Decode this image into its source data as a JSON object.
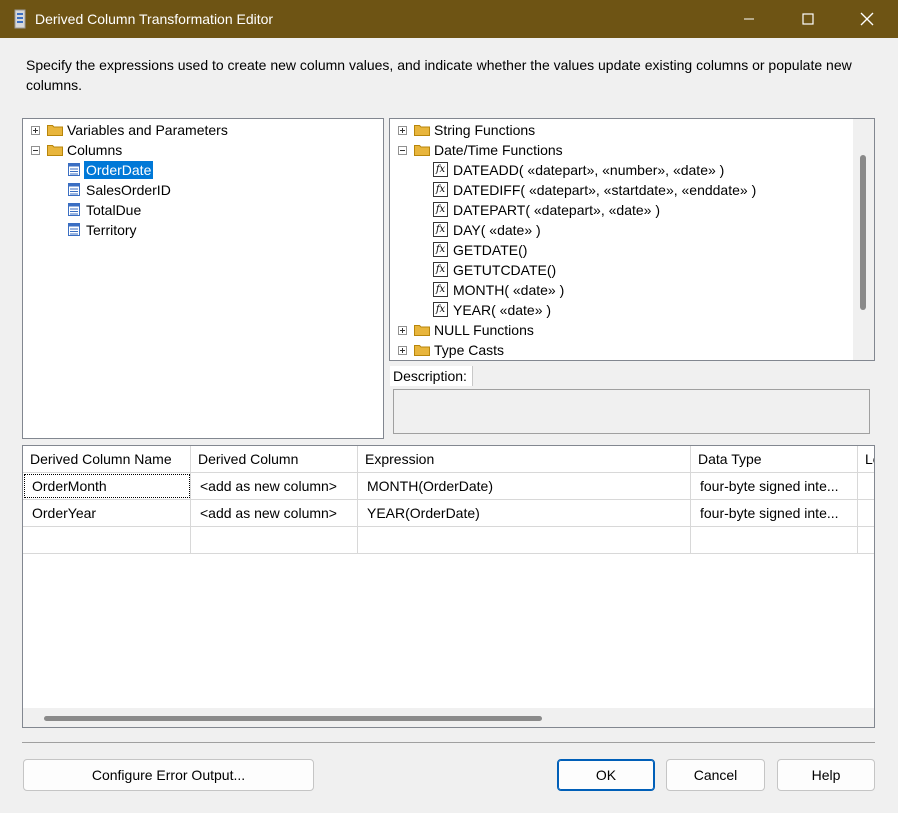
{
  "window": {
    "title": "Derived Column Transformation Editor",
    "minimize": "",
    "maximize": "☐",
    "close": "✕"
  },
  "instructions": "Specify the expressions used to create new column values, and indicate whether the values update existing columns or populate new columns.",
  "left_tree": {
    "variables": "Variables and Parameters",
    "columns": "Columns",
    "column_items": [
      "OrderDate",
      "SalesOrderID",
      "TotalDue",
      "Territory"
    ],
    "selected": "OrderDate"
  },
  "right_tree": {
    "string_functions": "String Functions",
    "datetime_functions": "Date/Time Functions",
    "functions": [
      "DATEADD( «datepart», «number», «date» )",
      "DATEDIFF( «datepart», «startdate», «enddate» )",
      "DATEPART( «datepart», «date» )",
      "DAY( «date» )",
      "GETDATE()",
      "GETUTCDATE()",
      "MONTH( «date» )",
      "YEAR( «date» )"
    ],
    "null_functions": "NULL Functions",
    "type_casts": "Type Casts",
    "fx_glyph": "fx"
  },
  "description": {
    "label": "Description:",
    "value": ""
  },
  "grid": {
    "headers": [
      "Derived Column Name",
      "Derived Column",
      "Expression",
      "Data Type",
      "Le"
    ],
    "rows": [
      [
        "OrderMonth",
        "<add as new column>",
        "MONTH(OrderDate)",
        "four-byte signed inte..."
      ],
      [
        "OrderYear",
        "<add as new column>",
        "YEAR(OrderDate)",
        "four-byte signed inte..."
      ]
    ]
  },
  "buttons": {
    "configure_error": "Configure Error Output...",
    "ok": "OK",
    "cancel": "Cancel",
    "help": "Help"
  },
  "colors": {
    "titlebar": "#6e5414",
    "selection": "#0078d7",
    "ok_border": "#005fb8",
    "folder": "#e8b53c"
  }
}
